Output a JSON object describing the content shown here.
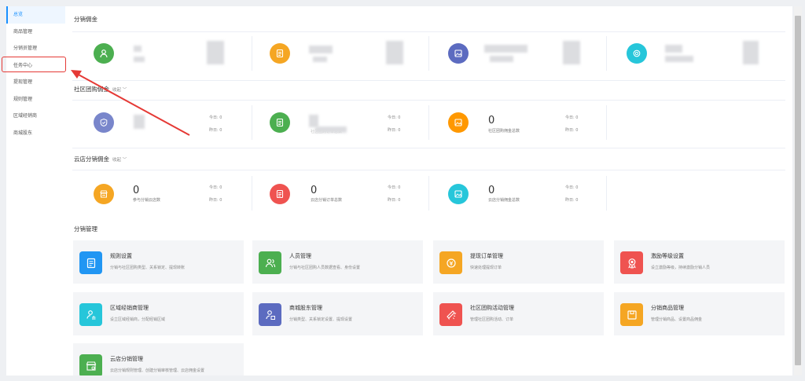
{
  "sidebar": {
    "items": [
      {
        "label": "总览",
        "active": true
      },
      {
        "label": "商品管理"
      },
      {
        "label": "分销员管理"
      },
      {
        "label": "任务中心"
      },
      {
        "label": "提现管理"
      },
      {
        "label": "规则管理"
      },
      {
        "label": "区域经销商"
      },
      {
        "label": "商城股东"
      }
    ]
  },
  "commission": {
    "title": "分销佣金",
    "items": [
      {
        "icon": "user-icon",
        "color": "#4caf50"
      },
      {
        "icon": "document-icon",
        "color": "#f5a623"
      },
      {
        "icon": "image-icon",
        "color": "#5c6bc0"
      },
      {
        "icon": "coin-icon",
        "color": "#26c6da"
      }
    ]
  },
  "community": {
    "title": "社区团购佣金",
    "toggle": "收起 ﹀",
    "items": [
      {
        "icon": "badge-icon",
        "color": "#7986cb",
        "num": "",
        "label": "",
        "today": "今日: 0",
        "yesterday": "昨日: 0"
      },
      {
        "icon": "document-icon",
        "color": "#4caf50",
        "num": "",
        "label": "社区团购订单总数",
        "today": "今日: 0",
        "yesterday": "昨日: 0"
      },
      {
        "icon": "image-icon",
        "color": "#ff9800",
        "num": "0",
        "label": "社区团购佣金总数",
        "today": "今日: 0",
        "yesterday": "昨日: 0"
      }
    ]
  },
  "cloud": {
    "title": "云店分销佣金",
    "toggle": "收起 ﹀",
    "items": [
      {
        "icon": "store-icon",
        "color": "#f5a623",
        "num": "0",
        "label": "参与分销云店数",
        "today": "今日: 0",
        "yesterday": "昨日: 0"
      },
      {
        "icon": "document-icon",
        "color": "#ef5350",
        "num": "0",
        "label": "云店分销订单总数",
        "today": "今日: 0",
        "yesterday": "昨日: 0"
      },
      {
        "icon": "image-icon",
        "color": "#26c6da",
        "num": "0",
        "label": "云店分销佣金总数",
        "today": "今日: 0",
        "yesterday": "昨日: 0"
      }
    ]
  },
  "management": {
    "title": "分销管理",
    "cards": [
      {
        "title": "规则设置",
        "desc": "分销与社区团购类型、关系锁定、提现转账",
        "icon": "rules-icon",
        "color": "#2196f3"
      },
      {
        "title": "人员管理",
        "desc": "分销与社区团购人员数据查看、身份设置",
        "icon": "people-icon",
        "color": "#4caf50"
      },
      {
        "title": "提现订单管理",
        "desc": "快速处理提现订单",
        "icon": "withdraw-icon",
        "color": "#f5a623"
      },
      {
        "title": "激励等级设置",
        "desc": "设立激励等级，持续激励分销人员",
        "icon": "medal-icon",
        "color": "#ef5350"
      },
      {
        "title": "区域经销商管理",
        "desc": "设立区域经销商，分配经销区域",
        "icon": "region-dealer-icon",
        "color": "#26c6da"
      },
      {
        "title": "商城股东管理",
        "desc": "分销类型、关系锁定设置、提现设置",
        "icon": "shareholder-icon",
        "color": "#5c6bc0"
      },
      {
        "title": "社区团购活动管理",
        "desc": "管理社区团购活动、订单",
        "icon": "megaphone-icon",
        "color": "#ef5350"
      },
      {
        "title": "分销商品管理",
        "desc": "管理分销商品、设置商品佣金",
        "icon": "goods-icon",
        "color": "#f5a623"
      },
      {
        "title": "云店分销管理",
        "desc": "云店分销规则管理、创建分销审核管理、云店佣金设置",
        "icon": "cloud-store-icon",
        "color": "#4caf50"
      }
    ]
  }
}
